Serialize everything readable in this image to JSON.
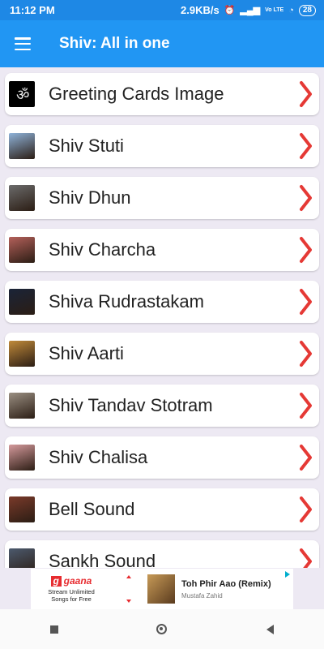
{
  "status_bar": {
    "time": "11:12 PM",
    "speed": "2.9KB/s",
    "network": "Vo LTE",
    "battery": "28"
  },
  "app_bar": {
    "title": "Shiv: All in one"
  },
  "list": {
    "items": [
      {
        "label": "Greeting Cards Image",
        "icon": "om-image",
        "thumb": "#000000"
      },
      {
        "label": "Shiv Stuti",
        "icon": "shiva-portrait",
        "thumb": "#8fb3d9"
      },
      {
        "label": "Shiv Dhun",
        "icon": "shiva-portrait",
        "thumb": "#6b6b6b"
      },
      {
        "label": "Shiv Charcha",
        "icon": "shiva-portrait",
        "thumb": "#b4605a"
      },
      {
        "label": "Shiva Rudrastakam",
        "icon": "shiva-portrait",
        "thumb": "#1a2438"
      },
      {
        "label": "Shiv Aarti",
        "icon": "shiva-portrait",
        "thumb": "#c08a3a"
      },
      {
        "label": "Shiv Tandav Stotram",
        "icon": "shiva-portrait",
        "thumb": "#9a8f82"
      },
      {
        "label": "Shiv Chalisa",
        "icon": "shiva-portrait",
        "thumb": "#d59a9c"
      },
      {
        "label": "Bell Sound",
        "icon": "bell-image",
        "thumb": "#7a3a2a"
      },
      {
        "label": "Sankh Sound",
        "icon": "conch-image",
        "thumb": "#4c5a6e"
      }
    ],
    "chevron_color": "#e53935"
  },
  "ad": {
    "brand": "gaana",
    "brand_letter": "g",
    "tagline_1": "Stream Unlimited",
    "tagline_2": "Songs for Free",
    "song": "Toh Phir Aao (Remix)",
    "artist": "Mustafa Zahid"
  },
  "colors": {
    "status_bar": "#1e88e5",
    "app_bar": "#2196f3",
    "background": "#ede9f3"
  }
}
